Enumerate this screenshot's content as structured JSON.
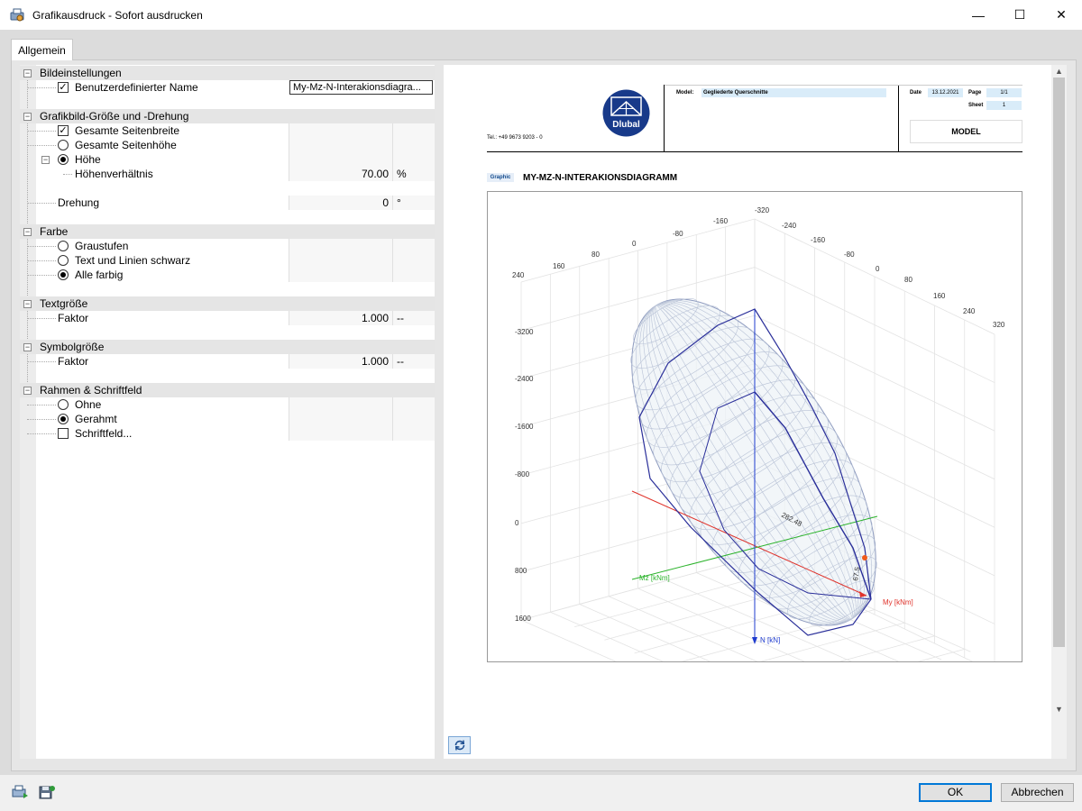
{
  "window": {
    "title": "Grafikausdruck - Sofort ausdrucken",
    "minimize": "—",
    "maximize": "☐",
    "close": "✕"
  },
  "tabs": [
    {
      "label": "Allgemein"
    }
  ],
  "settings": {
    "bild": {
      "label": "Bildeinstellungen",
      "custom_name_label": "Benutzerdefinierter Name",
      "custom_name_checked": true,
      "custom_name_value": "My-Mz-N-Interakionsdiagra..."
    },
    "groesse": {
      "label": "Grafikbild-Größe und -Drehung",
      "seitenbreite": "Gesamte Seitenbreite",
      "seitenhoehe": "Gesamte Seitenhöhe",
      "hoehe": "Höhe",
      "verhaeltnis_label": "Höhenverhältnis",
      "verhaeltnis_value": "70.00",
      "verhaeltnis_unit": "%",
      "drehung_label": "Drehung",
      "drehung_value": "0",
      "drehung_unit": "°"
    },
    "farbe": {
      "label": "Farbe",
      "graustufen": "Graustufen",
      "schwarz": "Text und Linien schwarz",
      "farbig": "Alle farbig"
    },
    "textgroesse": {
      "label": "Textgröße",
      "faktor_label": "Faktor",
      "faktor_value": "1.000",
      "faktor_unit": "--"
    },
    "symbolgroesse": {
      "label": "Symbolgröße",
      "faktor_label": "Faktor",
      "faktor_value": "1.000",
      "faktor_unit": "--"
    },
    "rahmen": {
      "label": "Rahmen & Schriftfeld",
      "ohne": "Ohne",
      "gerahmt": "Gerahmt",
      "schriftfeld": "Schriftfeld..."
    }
  },
  "preview": {
    "tel": "Tel.: +49 9673 9203 - 0",
    "logo_text": "Dlubal",
    "model_label": "Model:",
    "model_value": "Gegliederte Querschnitte",
    "date_label": "Date",
    "date_value": "13.12.2021",
    "page_label": "Page",
    "page_value": "1/1",
    "sheet_label": "Sheet",
    "sheet_value": "1",
    "model_word": "MODEL",
    "graphic_tag": "Graphic",
    "graphic_title": "MY-MZ-N-INTERAKIONSDIAGRAMM"
  },
  "chart_data": {
    "type": "scatter",
    "title": "",
    "top_axis_ticks": [
      "240",
      "160",
      "80",
      "0",
      "-80",
      "-160",
      "-320"
    ],
    "right_axis_ticks": [
      "-240",
      "-160",
      "-80",
      "0",
      "80",
      "160",
      "240",
      "320"
    ],
    "n_axis_ticks": [
      "-3200",
      "-2400",
      "-1600",
      "-800",
      "0",
      "800",
      "1600"
    ],
    "axis_labels": {
      "my": "My [kNm]",
      "mz": "Mz [kNm]",
      "n": "N [kN]"
    },
    "annotations": [
      "282.48",
      "67.5"
    ],
    "colors": {
      "my": "#e0332b",
      "mz": "#2bb32b",
      "n": "#1f3ccf",
      "mesh": "#8e9bbf",
      "path": "#2a2f9a"
    }
  },
  "footer": {
    "ok": "OK",
    "cancel": "Abbrechen"
  }
}
